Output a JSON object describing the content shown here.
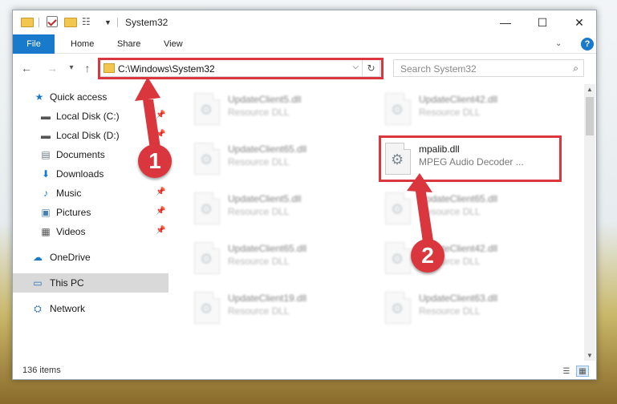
{
  "window": {
    "title": "System32",
    "controls": {
      "minimize": "—",
      "maximize": "☐",
      "close": "✕"
    }
  },
  "ribbon": {
    "tabs": [
      {
        "label": "File"
      },
      {
        "label": "Home"
      },
      {
        "label": "Share"
      },
      {
        "label": "View"
      }
    ],
    "help": "?",
    "file_tab_color": "#1979ca"
  },
  "navigation": {
    "back": "←",
    "forward": "→",
    "recent": "▾",
    "up": "↑",
    "address": "C:\\Windows\\System32",
    "address_dropdown": "⌵",
    "refresh": "↻",
    "search_placeholder": "Search System32",
    "search_icon": "⌕"
  },
  "sidebar": {
    "items": [
      {
        "label": "Quick access",
        "icon": "★",
        "icon_name": "star-icon",
        "pinned": false
      },
      {
        "label": "Local Disk (C:)",
        "icon": "▬",
        "icon_name": "drive-icon",
        "pinned": true
      },
      {
        "label": "Local Disk (D:)",
        "icon": "▬",
        "icon_name": "drive-icon",
        "pinned": true
      },
      {
        "label": "Documents",
        "icon": "▤",
        "icon_name": "documents-icon",
        "pinned": true
      },
      {
        "label": "Downloads",
        "icon": "⬇",
        "icon_name": "downloads-icon",
        "pinned": true
      },
      {
        "label": "Music",
        "icon": "♪",
        "icon_name": "music-icon",
        "pinned": true
      },
      {
        "label": "Pictures",
        "icon": "▣",
        "icon_name": "pictures-icon",
        "pinned": true
      },
      {
        "label": "Videos",
        "icon": "▦",
        "icon_name": "videos-icon",
        "pinned": true
      },
      {
        "label": "OneDrive",
        "icon": "☁",
        "icon_name": "onedrive-icon",
        "pinned": false
      },
      {
        "label": "This PC",
        "icon": "▭",
        "icon_name": "computer-icon",
        "pinned": false,
        "selected": true
      },
      {
        "label": "Network",
        "icon": "⛭",
        "icon_name": "network-icon",
        "pinned": false
      }
    ],
    "pin_glyph": "📌"
  },
  "files": [
    {
      "name": "UpdateClient5.dll",
      "type": "Resource DLL",
      "blurred": true
    },
    {
      "name": "UpdateClient42.dll",
      "type": "Resource DLL",
      "blurred": true
    },
    {
      "name": "UpdateClient65.dll",
      "type": "Resource DLL",
      "blurred": true
    },
    {
      "name": "mpalib.dll",
      "type": "MPEG Audio Decoder ...",
      "blurred": false,
      "highlighted": true
    },
    {
      "name": "UpdateClient5.dll",
      "type": "Resource DLL",
      "blurred": true
    },
    {
      "name": "UpdateClient65.dll",
      "type": "Resource DLL",
      "blurred": true
    },
    {
      "name": "UpdateClient65.dll",
      "type": "Resource DLL",
      "blurred": true
    },
    {
      "name": "UpdateClient42.dll",
      "type": "Resource DLL",
      "blurred": true
    },
    {
      "name": "UpdateClient19.dll",
      "type": "Resource DLL",
      "blurred": true
    },
    {
      "name": "UpdateClient63.dll",
      "type": "Resource DLL",
      "blurred": true
    }
  ],
  "status": {
    "item_count": "136 items"
  },
  "callouts": [
    {
      "number": "1"
    },
    {
      "number": "2"
    }
  ],
  "colors": {
    "highlight": "#d9373d",
    "accent": "#1979ca"
  }
}
